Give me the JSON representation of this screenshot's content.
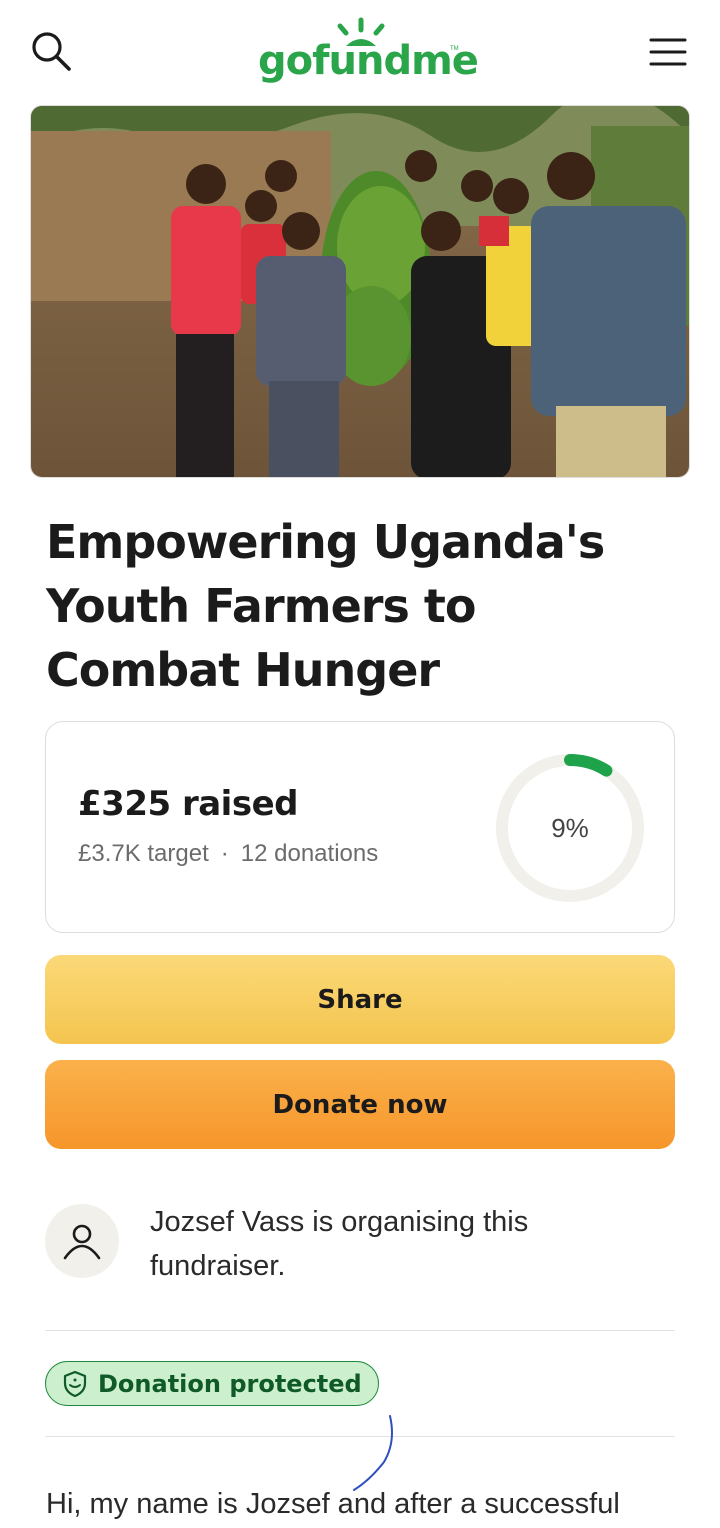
{
  "header": {
    "logo_text": "gofundme",
    "logo_tm": "TM",
    "brand_color": "#2aa54a",
    "icons": {
      "search": "search-icon",
      "menu": "hamburger-menu-icon"
    }
  },
  "hero": {
    "image": "photo of youth farmers holding bananas"
  },
  "campaign": {
    "title": "Empowering Uganda's Youth Farmers to Combat Hunger"
  },
  "stats": {
    "raised": "£325 raised",
    "target": "£3.7K target",
    "separator": "·",
    "donations": "12 donations",
    "percent_label": "9%",
    "progress_fraction": 0.09,
    "progress_color": "#1ea34a"
  },
  "actions": {
    "share_label": "Share",
    "donate_label": "Donate now"
  },
  "organiser": {
    "text": "Jozsef Vass is organising this fundraiser.",
    "avatar_icon": "user-icon"
  },
  "protection": {
    "label": "Donation protected",
    "icon": "shield-icon"
  },
  "story": {
    "first_line": "Hi, my name is Jozsef and after a successful"
  }
}
